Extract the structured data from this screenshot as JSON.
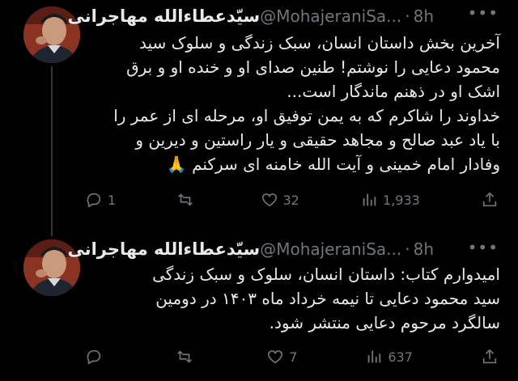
{
  "tweets": [
    {
      "author_name": "سیّدعطاءالله مهاجرانی",
      "handle": "@MohajeraniSa...",
      "time": "8h",
      "body_lines": [
        "آخرین بخش داستان انسان، سبک زندگی و سلوک سید",
        "محمود دعایی را نوشتم! طنین صدای او و خنده او و برق",
        "اشک او در ذهنم ماندگار است...",
        "خداوند را شاکرم که به یمن توفیق او، مرحله ای از عمر را",
        "با یاد عبد صالح و مجاهد حقیقی و یار راستین و دیرین و",
        "وفادار امام خمینی و آیت الله خامنه ای سرکنم 🙏"
      ],
      "replies": "1",
      "retweets": "",
      "likes": "32",
      "views": "1,933"
    },
    {
      "author_name": "سیّدعطاءالله مهاجرانی",
      "handle": "@MohajeraniSa...",
      "time": "8h",
      "body_lines": [
        "امیدوارم کتاب: داستان انسان، سلوک و سبک زندگی",
        "سید محمود دعایی تا نیمه خرداد ماه ۱۴۰۳ در دومین",
        "سالگرد مرحوم دعایی منتشر شود."
      ],
      "replies": "",
      "retweets": "",
      "likes": "7",
      "views": "637"
    }
  ],
  "icons": {
    "reply": "reply-icon",
    "retweet": "retweet-icon",
    "like": "heart-icon",
    "views": "views-icon",
    "share": "share-icon",
    "more": "more-icon"
  },
  "colors": {
    "background": "#000000",
    "text": "#e7e9ea",
    "muted": "#71767b",
    "thread_line": "#333639"
  }
}
